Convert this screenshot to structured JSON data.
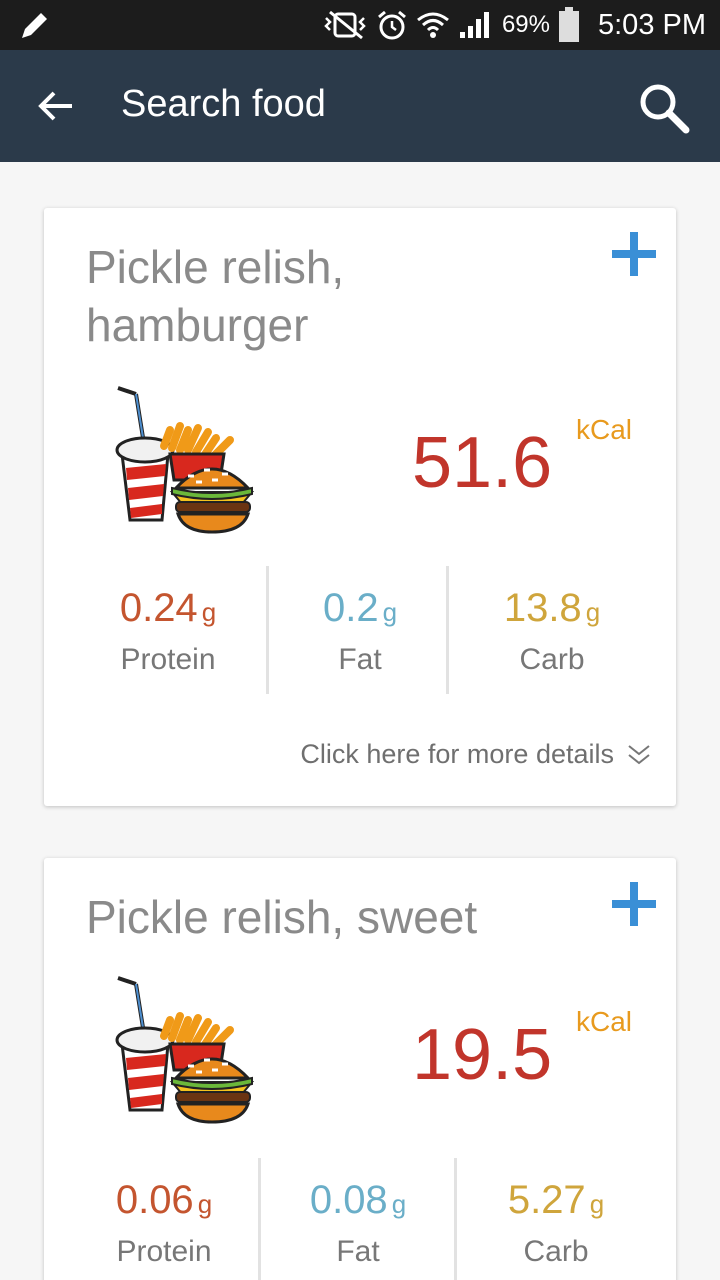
{
  "status_bar": {
    "battery": "69%",
    "time": "5:03 PM"
  },
  "app_bar": {
    "title": "Search food"
  },
  "colors": {
    "app_bar": "#2b3a4a",
    "kcal": "#c1352b",
    "kcal_unit": "#e89a1e",
    "protein": "#c4552f",
    "fat": "#6aaec8",
    "carb": "#cfa53c",
    "add": "#3a8fd6"
  },
  "foods": [
    {
      "name": "Pickle relish, hamburger",
      "kcal": "51.6",
      "kcal_unit": "kCal",
      "protein": "0.24",
      "protein_label": "Protein",
      "fat": "0.2",
      "fat_label": "Fat",
      "carb": "13.8",
      "carb_label": "Carb",
      "unit": "g",
      "more_label": "Click here for more details"
    },
    {
      "name": "Pickle relish, sweet",
      "kcal": "19.5",
      "kcal_unit": "kCal",
      "protein": "0.06",
      "protein_label": "Protein",
      "fat": "0.08",
      "fat_label": "Fat",
      "carb": "5.27",
      "carb_label": "Carb",
      "unit": "g"
    }
  ]
}
